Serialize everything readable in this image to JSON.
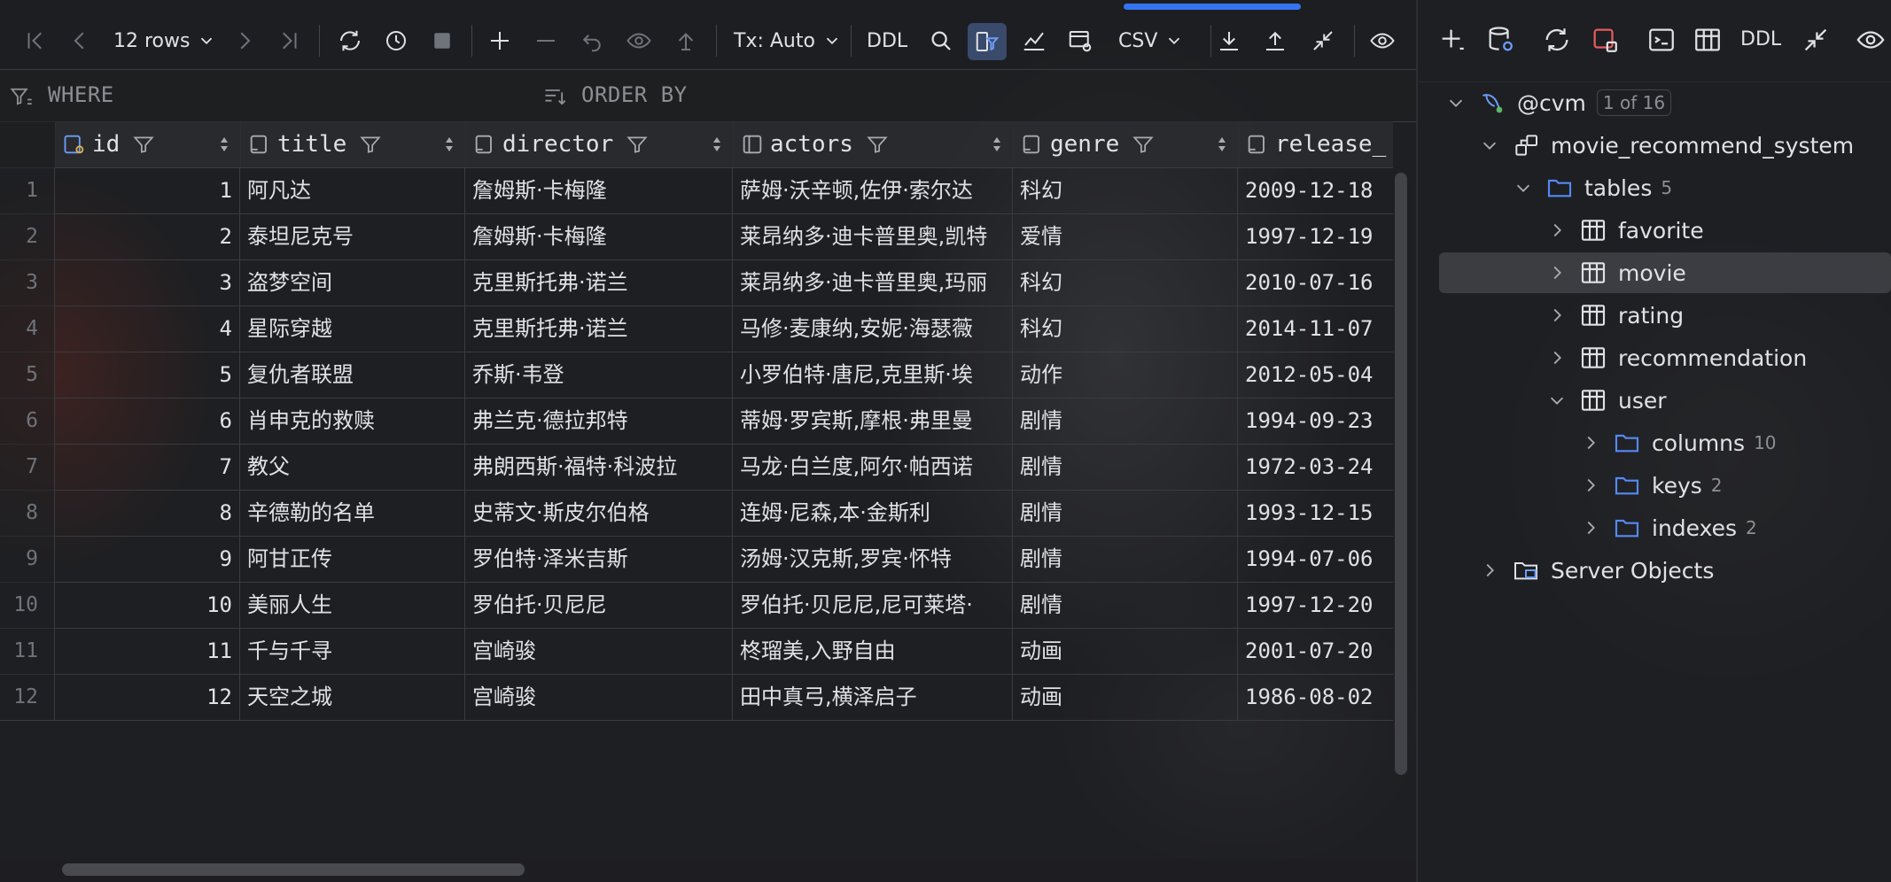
{
  "toolbar": {
    "rows_label": "12 rows",
    "tx_label": "Tx: Auto",
    "ddl_label": "DDL",
    "export_format": "CSV",
    "accent_color": "#3574f0"
  },
  "filter": {
    "where_label": "WHERE",
    "orderby_label": "ORDER BY"
  },
  "table": {
    "columns": [
      "id",
      "title",
      "director",
      "actors",
      "genre",
      "release_"
    ],
    "rows": [
      {
        "n": "1",
        "id": "1",
        "title": "阿凡达",
        "director": "詹姆斯·卡梅隆",
        "actors": "萨姆·沃辛顿,佐伊·索尔达",
        "genre": "科幻",
        "release": "2009-12-18"
      },
      {
        "n": "2",
        "id": "2",
        "title": "泰坦尼克号",
        "director": "詹姆斯·卡梅隆",
        "actors": "莱昂纳多·迪卡普里奥,凯特",
        "genre": "爱情",
        "release": "1997-12-19"
      },
      {
        "n": "3",
        "id": "3",
        "title": "盗梦空间",
        "director": "克里斯托弗·诺兰",
        "actors": "莱昂纳多·迪卡普里奥,玛丽",
        "genre": "科幻",
        "release": "2010-07-16"
      },
      {
        "n": "4",
        "id": "4",
        "title": "星际穿越",
        "director": "克里斯托弗·诺兰",
        "actors": "马修·麦康纳,安妮·海瑟薇",
        "genre": "科幻",
        "release": "2014-11-07"
      },
      {
        "n": "5",
        "id": "5",
        "title": "复仇者联盟",
        "director": "乔斯·韦登",
        "actors": "小罗伯特·唐尼,克里斯·埃",
        "genre": "动作",
        "release": "2012-05-04"
      },
      {
        "n": "6",
        "id": "6",
        "title": "肖申克的救赎",
        "director": "弗兰克·德拉邦特",
        "actors": "蒂姆·罗宾斯,摩根·弗里曼",
        "genre": "剧情",
        "release": "1994-09-23"
      },
      {
        "n": "7",
        "id": "7",
        "title": "教父",
        "director": "弗朗西斯·福特·科波拉",
        "actors": "马龙·白兰度,阿尔·帕西诺",
        "genre": "剧情",
        "release": "1972-03-24"
      },
      {
        "n": "8",
        "id": "8",
        "title": "辛德勒的名单",
        "director": "史蒂文·斯皮尔伯格",
        "actors": "连姆·尼森,本·金斯利",
        "genre": "剧情",
        "release": "1993-12-15"
      },
      {
        "n": "9",
        "id": "9",
        "title": "阿甘正传",
        "director": "罗伯特·泽米吉斯",
        "actors": "汤姆·汉克斯,罗宾·怀特",
        "genre": "剧情",
        "release": "1994-07-06"
      },
      {
        "n": "10",
        "id": "10",
        "title": "美丽人生",
        "director": "罗伯托·贝尼尼",
        "actors": "罗伯托·贝尼尼,尼可莱塔·",
        "genre": "剧情",
        "release": "1997-12-20"
      },
      {
        "n": "11",
        "id": "11",
        "title": "千与千寻",
        "director": "宫崎骏",
        "actors": "柊瑠美,入野自由",
        "genre": "动画",
        "release": "2001-07-20"
      },
      {
        "n": "12",
        "id": "12",
        "title": "天空之城",
        "director": "宫崎骏",
        "actors": "田中真弓,横泽启子",
        "genre": "动画",
        "release": "1986-08-02"
      }
    ]
  },
  "explorer": {
    "ddl_label": "DDL",
    "connection": "@cvm",
    "connection_badge": "1 of 16",
    "schema": "movie_recommend_system",
    "tables_label": "tables",
    "tables_count": "5",
    "tables": [
      "favorite",
      "movie",
      "rating",
      "recommendation",
      "user"
    ],
    "user_children": [
      {
        "label": "columns",
        "count": "10"
      },
      {
        "label": "keys",
        "count": "2"
      },
      {
        "label": "indexes",
        "count": "2"
      }
    ],
    "server_objects": "Server Objects",
    "folder_color": "#548af7"
  }
}
